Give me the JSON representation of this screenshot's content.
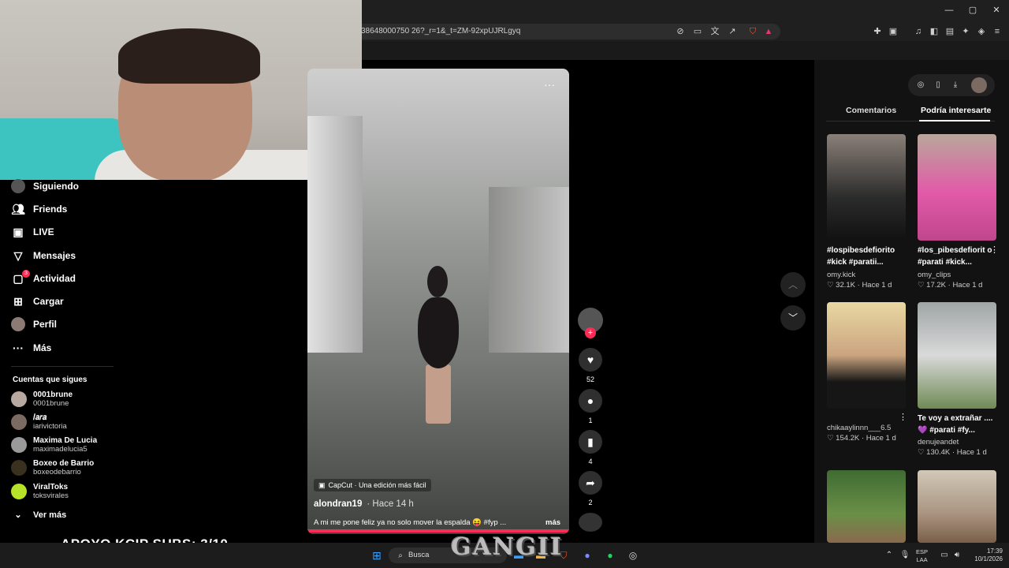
{
  "browser": {
    "url": "38648000750 26?_r=1&_t=ZM-92xpUJRLgyq",
    "window_controls": {
      "minimize": "—",
      "maximize": "▢",
      "close": "✕"
    }
  },
  "sidebar": {
    "items": [
      {
        "label": "Siguiendo",
        "icon": "following-avatar-icon"
      },
      {
        "label": "Friends",
        "icon": "friends-icon"
      },
      {
        "label": "LIVE",
        "icon": "live-icon"
      },
      {
        "label": "Mensajes",
        "icon": "messages-icon"
      },
      {
        "label": "Actividad",
        "icon": "activity-icon",
        "badge": "3"
      },
      {
        "label": "Cargar",
        "icon": "upload-icon"
      },
      {
        "label": "Perfil",
        "icon": "profile-icon"
      },
      {
        "label": "Más",
        "icon": "more-icon"
      }
    ],
    "following_title": "Cuentas que sigues",
    "accounts": [
      {
        "name": "0001brune",
        "id": "0001brune"
      },
      {
        "name": "𝐼𝑎𝑟𝑎",
        "id": "iarivictoria"
      },
      {
        "name": "Maxima De Lucia",
        "id": "maximadelucia5"
      },
      {
        "name": "Boxeo de Barrio",
        "id": "boxeodebarrio"
      },
      {
        "name": "ViralToks",
        "id": "toksvirales"
      }
    ],
    "see_more": "Ver más"
  },
  "video": {
    "capcut_label": "CapCut · Una edición más fácil",
    "author": "alondran19",
    "time": "· Hace 14 h",
    "caption": "A mi me pone feliz ya no solo mover la espalda 😝 #fyp ...",
    "more": "más",
    "menu": "···",
    "progress": 1.0
  },
  "actions": {
    "likes": "52",
    "comments": "1",
    "saves": "4",
    "shares": "2"
  },
  "right_panel": {
    "tabs": [
      "Comentarios",
      "Podría interesarte"
    ],
    "active_tab": 1,
    "cards": [
      {
        "title": "#lospibesdefiorito #kick #paratii...",
        "user": "omy.kick",
        "likes": "32.1K",
        "time": "Hace 1 d"
      },
      {
        "title": "#los_pibesdefiorit o #parati #kick...",
        "user": "omy_clips",
        "likes": "17.2K",
        "time": "Hace 1 d"
      },
      {
        "title": "",
        "user": "chikaaylinnn___6.5",
        "likes": "154.2K",
        "time": "Hace 1 d"
      },
      {
        "title": "Te voy a extrañar .... 💜 #parati #fy...",
        "user": "denujeandet",
        "likes": "130.4K",
        "time": "Hace 1 d"
      }
    ]
  },
  "overlay": {
    "subs": "APOYO KCIP SUBS: 3/10",
    "brand": "GANGII"
  },
  "taskbar": {
    "search": "Busca",
    "lang_top": "ESP",
    "lang_bottom": "LAA",
    "time": "17:39",
    "date": "10/1/2026"
  }
}
